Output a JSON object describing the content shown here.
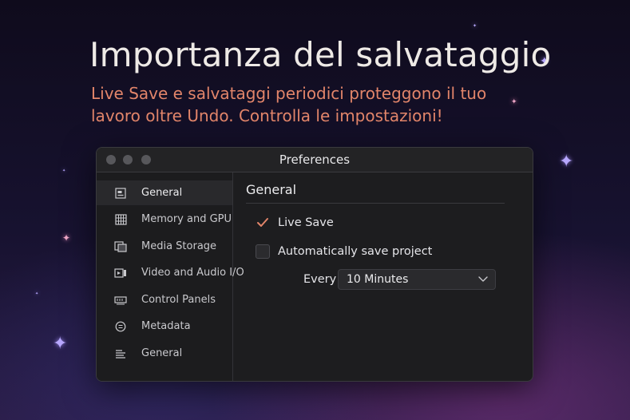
{
  "hero": {
    "title": "Importanza del salvataggio",
    "subtitle": "Live Save e salvataggi periodici proteggono il tuo lavoro oltre Undo. Controlla le impostazioni!"
  },
  "window": {
    "title": "Preferences"
  },
  "sidebar": {
    "items": [
      {
        "label": "General",
        "icon": "general-settings-icon",
        "active": true
      },
      {
        "label": "Memory and GPU",
        "icon": "memory-gpu-icon",
        "active": false
      },
      {
        "label": "Media Storage",
        "icon": "media-storage-icon",
        "active": false
      },
      {
        "label": "Video and Audio I/O",
        "icon": "video-audio-io-icon",
        "active": false
      },
      {
        "label": "Control Panels",
        "icon": "control-panels-icon",
        "active": false
      },
      {
        "label": "Metadata",
        "icon": "metadata-icon",
        "active": false
      },
      {
        "label": "General",
        "icon": "list-lines-icon",
        "active": false
      }
    ]
  },
  "content": {
    "section_title": "General",
    "live_save": {
      "label": "Live Save",
      "checked": true
    },
    "auto_save": {
      "label": "Automatically save project",
      "checked": false
    },
    "every": {
      "label": "Every",
      "selected": "10 Minutes"
    }
  },
  "colors": {
    "accent_check": "#e2856a",
    "subtitle": "#e2856a",
    "window_bg": "#1d1d1f"
  }
}
